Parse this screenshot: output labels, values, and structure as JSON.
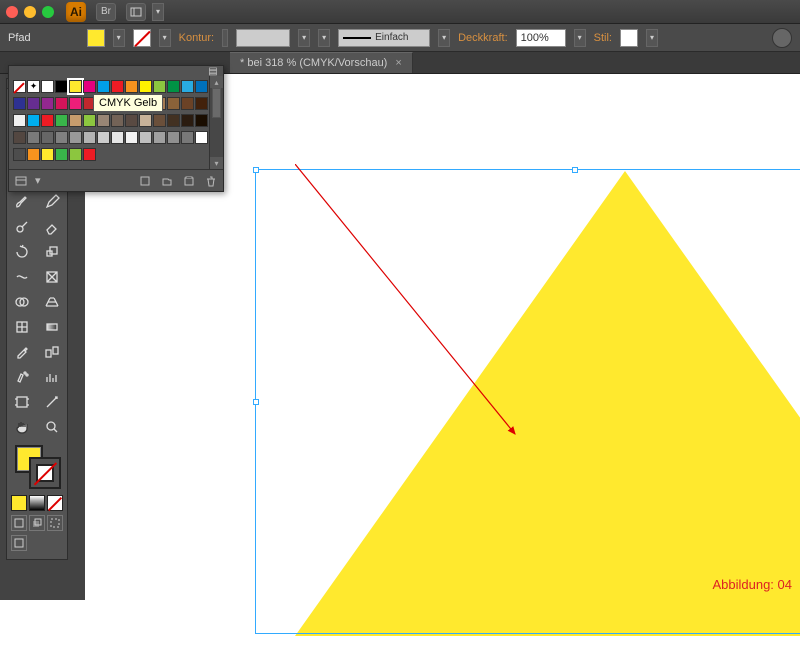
{
  "titleBar": {
    "appAbbrev": "Ai",
    "brLabel": "Br"
  },
  "controlBar": {
    "objectType": "Pfad",
    "konturLabel": "Kontur:",
    "strokeStyleLabel": "Einfach",
    "opacityLabel": "Deckkraft:",
    "opacityValue": "100%",
    "styleLabel": "Stil:",
    "fillColor": "#ffe92e"
  },
  "documentTab": {
    "label": "* bei 318 % (CMYK/Vorschau)",
    "close": "×"
  },
  "swatches": {
    "tooltip": "CMYK Gelb",
    "row1": [
      "none",
      "reg",
      "#ffffff",
      "#000000",
      "#ffe92e",
      "#e4007e",
      "#00a0e9",
      "#ed1c24",
      "#f7931e",
      "#fff200",
      "#8cc63f",
      "#009245",
      "#29abe2",
      "#0071bc"
    ],
    "row2": [
      "#2e3192",
      "#662d91",
      "#93278f",
      "#d4145a",
      "#ed1e79",
      "#c1272d",
      "#8b5e3c",
      "#603813",
      "#754c24",
      "#b08030",
      "#a67c52",
      "#8a6239",
      "#6b4226",
      "#42210b"
    ],
    "row3": [
      "#f0f0f0",
      "#00aeef",
      "#ed1c24",
      "#39b54a",
      "#c69c6d",
      "#8cc63f",
      "#998675",
      "#736357",
      "#594a42",
      "#c7b299",
      "#6a4f3a",
      "#423122",
      "#2b1c10",
      "#1a0d00"
    ],
    "row4": [
      "#534741",
      "#7a7a7a",
      "#666666",
      "#808080",
      "#999999",
      "#b3b3b3",
      "#cccccc",
      "#e6e6e6",
      "#f2f2f2",
      "#c0c0c0",
      "#a0a0a0",
      "#909090",
      "#787878",
      "#ffffff"
    ],
    "row5": [
      "#4d4d4d",
      "#f7931e",
      "#ffe92e",
      "#39b54a",
      "#8cc63f",
      "#ed1c24"
    ],
    "selectedIndex": 4
  },
  "canvas": {
    "triangleFill": "#ffe92e",
    "figureLabel": "Abbildung: 04"
  }
}
